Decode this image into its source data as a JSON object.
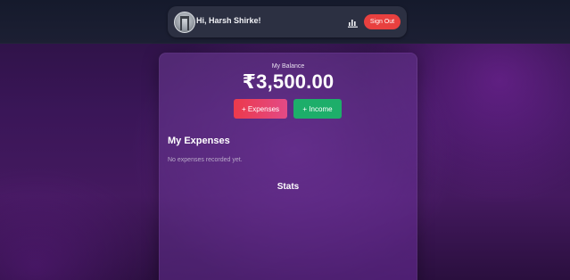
{
  "header": {
    "greeting": "Hi, Harsh Shirke!",
    "stats_icon": "bar-chart-icon",
    "sign_out_label": "Sign Out",
    "accent": "#e8403f"
  },
  "balance": {
    "label": "My Balance",
    "amount": "₹3,500.00"
  },
  "actions": {
    "expenses_label": "+ Expenses",
    "income_label": "+ Income",
    "expenses_color": "#ec3a4c",
    "income_color": "#1dae6a"
  },
  "expenses": {
    "title": "My Expenses",
    "empty_text": "No expenses recorded yet."
  },
  "stats": {
    "title": "Stats"
  }
}
